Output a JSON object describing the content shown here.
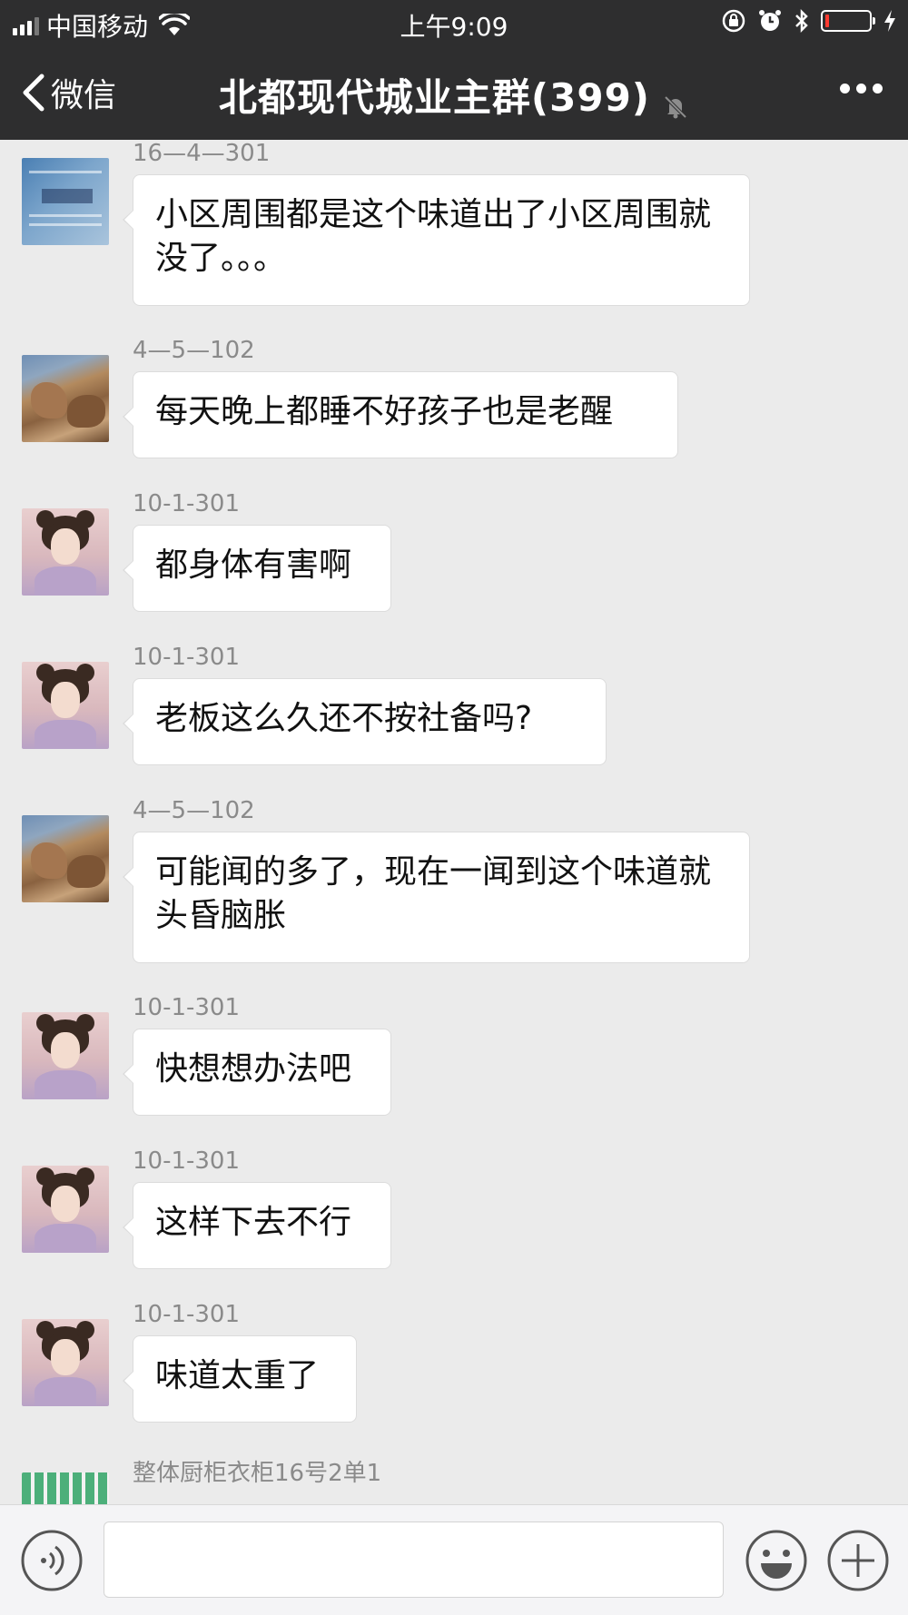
{
  "status_bar": {
    "carrier": "中国移动",
    "time": "上午9:09"
  },
  "nav": {
    "back_label": "微信",
    "title": "北都现代城业主群(399)"
  },
  "messages": [
    {
      "sender": "16—4—301",
      "text": "小区周围都是这个味道出了小区周围就没了。。。",
      "avatar": "avatar-health-patch"
    },
    {
      "sender": "4—5—102",
      "text": "每天晚上都睡不好孩子也是老醒",
      "avatar": "avatar-rocks"
    },
    {
      "sender": "10-1-301",
      "text": "都身体有害啊",
      "avatar": "avatar-girl"
    },
    {
      "sender": "10-1-301",
      "text": "老板这么久还不按社备吗?",
      "avatar": "avatar-girl"
    },
    {
      "sender": "4—5—102",
      "text": "可能闻的多了，现在一闻到这个味道就头昏脑胀",
      "avatar": "avatar-rocks"
    },
    {
      "sender": "10-1-301",
      "text": "快想想办法吧",
      "avatar": "avatar-girl"
    },
    {
      "sender": "10-1-301",
      "text": "这样下去不行",
      "avatar": "avatar-girl"
    },
    {
      "sender": "10-1-301",
      "text": "味道太重了",
      "avatar": "avatar-girl"
    },
    {
      "sender": "整体厨柜衣柜16号2单1",
      "text": "",
      "avatar": "avatar-mosaic"
    }
  ],
  "input_bar": {
    "message_value": "",
    "icons": [
      "voice-icon",
      "emoji-icon",
      "plus-icon"
    ]
  },
  "colors": {
    "header_bg": "#2e2e2f",
    "chat_bg": "#ebebeb",
    "bubble_bg": "#ffffff",
    "sender_text": "#8a8a8a",
    "battery_low": "#ff3b30"
  }
}
